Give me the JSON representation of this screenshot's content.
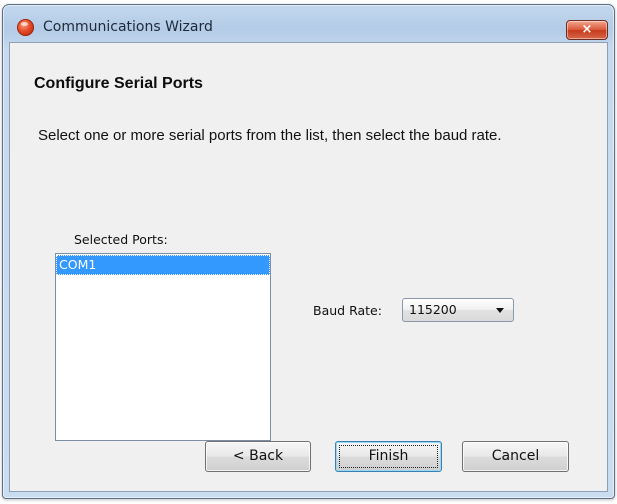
{
  "window": {
    "title": "Communications Wizard",
    "close_label": "×"
  },
  "page": {
    "heading": "Configure Serial Ports",
    "instruction": "Select one or more serial ports from the list, then select the baud rate."
  },
  "ports": {
    "label": "Selected Ports:",
    "items": [
      "COM1"
    ],
    "selected": "COM1"
  },
  "baud": {
    "label": "Baud Rate:",
    "value": "115200"
  },
  "buttons": {
    "back": "< Back",
    "finish": "Finish",
    "cancel": "Cancel",
    "focused": "finish"
  },
  "colors": {
    "selection": "#3399ff",
    "dialog_background": "#f0f0f0",
    "close_button": "#c53b1d"
  },
  "icons": {
    "app": "red-sphere-icon",
    "close": "close-icon",
    "dropdown": "chevron-down-icon"
  }
}
